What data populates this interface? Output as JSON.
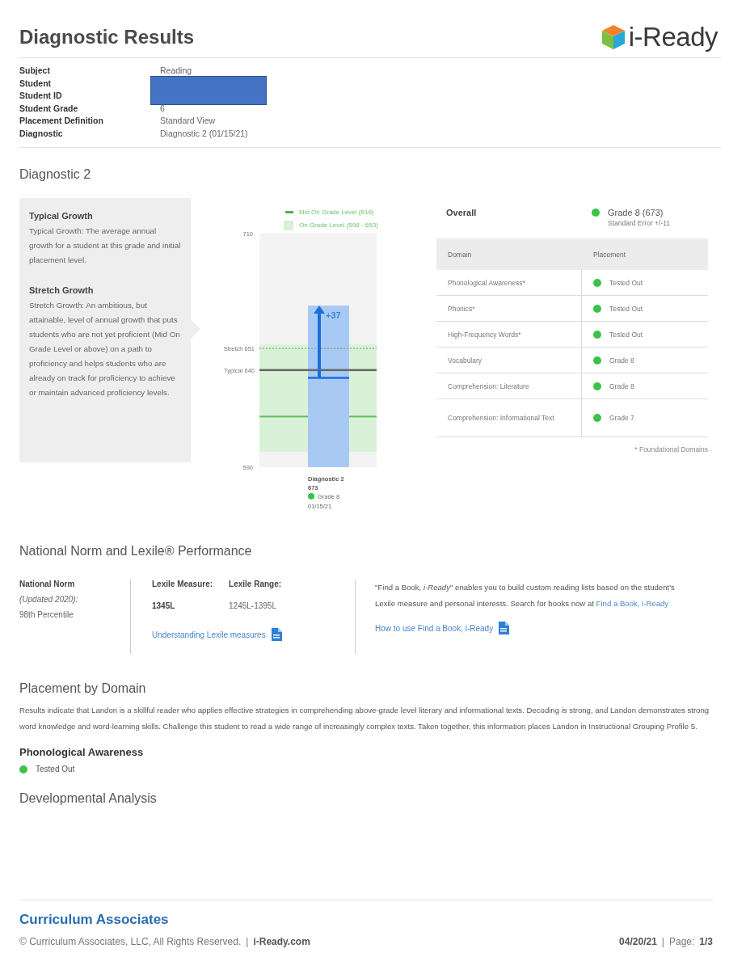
{
  "header": {
    "title": "Diagnostic Results",
    "logo_text": "i-Ready"
  },
  "info": [
    {
      "label": "Subject",
      "value": "Reading"
    },
    {
      "label": "Student",
      "redacted": true
    },
    {
      "label": "Student ID",
      "redacted": true
    },
    {
      "label": "Student Grade",
      "value": "6"
    },
    {
      "label": "Placement Definition",
      "value": "Standard View"
    },
    {
      "label": "Diagnostic",
      "value": "Diagnostic 2 (01/15/21)"
    }
  ],
  "diagnostic_section": {
    "title": "Diagnostic 2",
    "growth_panel": [
      {
        "heading": "Typical Growth",
        "text": "Typical Growth: The average annual growth for a student at this grade and initial placement level."
      },
      {
        "heading": "Stretch Growth",
        "text": "Stretch Growth: An ambitious, but attainable, level of annual growth that puts students who are not yet proficient (Mid On Grade Level or above) on a path to proficiency and helps students who are already on track for proficiency to achieve or maintain advanced proficiency levels."
      }
    ],
    "chart": {
      "legend": [
        {
          "kind": "line",
          "label": "Mid On Grade Level (616)"
        },
        {
          "kind": "band",
          "label": "On Grade Level (598 - 653)"
        }
      ],
      "bar_caption": {
        "score": "673",
        "grade": "Grade 8",
        "date": "01/15/21",
        "color": "#3cc24a"
      },
      "chart_data": {
        "type": "bar",
        "categories": [
          "Diagnostic 2"
        ],
        "values": [
          673
        ],
        "ylim": [
          590,
          710
        ],
        "yticks": [
          590,
          710
        ],
        "bands": [
          {
            "axis": "y",
            "from": 598,
            "to": 653,
            "color": "#d9f1d6"
          }
        ],
        "ref_lines": [
          {
            "axis": "y",
            "value": 616,
            "color": "#5cc25a"
          },
          {
            "axis": "y",
            "value": 651,
            "label": "Stretch 651",
            "color": "#6a9a6a"
          },
          {
            "axis": "y",
            "value": 640,
            "label": "Typical 640",
            "color": "#666666"
          }
        ],
        "annotations": [
          "+37"
        ]
      }
    },
    "overall": {
      "label": "Overall",
      "placement": "Grade 8 (673)",
      "standard_error": "Standard Error +/-11",
      "color": "#3cc24a"
    },
    "domain_table": {
      "columns": [
        "Domain",
        "Placement"
      ],
      "rows": [
        {
          "domain": "Phonological Awareness*",
          "placement": "Tested Out",
          "color": "#3cc24a"
        },
        {
          "domain": "Phonics*",
          "placement": "Tested Out",
          "color": "#3cc24a"
        },
        {
          "domain": "High-Frequency Words*",
          "placement": "Tested Out",
          "color": "#3cc24a"
        },
        {
          "domain": "Vocabulary",
          "placement": "Grade 8",
          "color": "#3cc24a"
        },
        {
          "domain": "Comprehension: Literature",
          "placement": "Grade 8",
          "color": "#3cc24a"
        },
        {
          "domain": "Comprehension: Informational Text",
          "placement": "Grade 7",
          "color": "#3cc24a"
        }
      ],
      "footnote": "* Foundational Domains"
    }
  },
  "norm_section": {
    "title": "National Norm and Lexile® Performance",
    "national_norm": {
      "label": "National Norm",
      "note": "(Updated 2020):",
      "value": "98th Percentile"
    },
    "lexile": {
      "measure_label": "Lexile Measure:",
      "measure": "1345L",
      "range_label": "Lexile Range:",
      "range": "1245L-1395L",
      "link": "Understanding Lexile measures"
    },
    "find_a_book": {
      "text": "\"Find a Book, *i-Ready*\" enables you to build custom reading lists based on the student's Lexile measure and personal interests. Search for books now at ",
      "inline_link": "Find a Book, i-Ready",
      "link": "How to use Find a Book, i-Ready"
    }
  },
  "placement_section": {
    "title": "Placement by Domain",
    "summary": "Results indicate that Landon is a skillful reader who applies effective strategies in comprehending above-grade level literary and informational texts. Decoding is strong, and Landon demonstrates strong word knowledge and word-learning skills. Challenge this student to read a wide range of increasingly complex texts. Taken together, this information places Landon in Instructional Grouping Profile 5.",
    "domain": {
      "heading": "Phonological Awareness",
      "status": "Tested Out",
      "color": "#3cc24a"
    },
    "next_heading": "Developmental Analysis"
  },
  "footer": {
    "brand": "Curriculum Associates",
    "copyright": "© Curriculum Associates, LLC, All Rights Reserved.",
    "separator": "|",
    "site": "i-Ready.com",
    "date": "04/20/21",
    "page_label": "Page:",
    "page": "1/3"
  }
}
